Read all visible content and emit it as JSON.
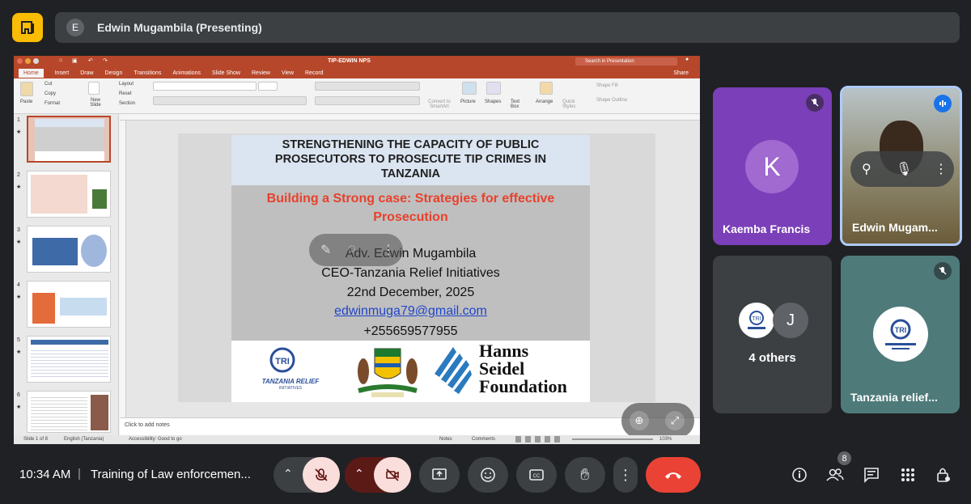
{
  "top": {
    "presenter_initial": "E",
    "presenter_label": "Edwin Mugambila (Presenting)"
  },
  "ppt": {
    "filename": "TIP-EDWIN NPS",
    "search_placeholder": "Search in Presentation",
    "share_label": "Share",
    "tabs": [
      "Home",
      "Insert",
      "Draw",
      "Design",
      "Transitions",
      "Animations",
      "Slide Show",
      "Review",
      "View",
      "Record"
    ],
    "ribbon": {
      "paste": "Paste",
      "cut": "Cut",
      "copy": "Copy",
      "format": "Format",
      "new_slide": "New Slide",
      "layout": "Layout",
      "reset": "Reset",
      "section": "Section",
      "convert": "Convert to SmartArt",
      "picture": "Picture",
      "shapes": "Shapes",
      "text_box": "Text Box",
      "arrange": "Arrange",
      "quick_styles": "Quick Styles",
      "shape_fill": "Shape Fill",
      "shape_outline": "Shape Outline"
    },
    "thumb_numbers": [
      "1",
      "2",
      "3",
      "4",
      "5",
      "6"
    ],
    "notes_placeholder": "Click to add notes",
    "status": {
      "slide_of": "Slide 1 of 8",
      "language": "English (Tanzania)",
      "accessibility": "Accessibility: Good to go",
      "notes": "Notes",
      "comments": "Comments",
      "zoom": "103%"
    }
  },
  "slide": {
    "title": "STRENGTHENING THE CAPACITY OF PUBLIC PROSECUTORS TO PROSECUTE TIP CRIMES IN TANZANIA",
    "subtitle": "Building a Strong case: Strategies for effective Prosecution",
    "presenter": "Adv. Edwin Mugambila",
    "role": "CEO-Tanzania Relief Initiatives",
    "date": "22nd  December, 2025",
    "email": "edwinmuga79@gmail.com",
    "phone": "+255659577955",
    "logo_left_name": "TANZANIA RELIEF",
    "logo_left_sub": "INITIATIVES",
    "logo_right_1": "Hanns",
    "logo_right_2": "Seidel",
    "logo_right_3": "Foundation",
    "title_color": "#1f1f1f",
    "subtitle_color": "#e8412c"
  },
  "tiles": {
    "kaemba_initial": "K",
    "kaemba_name": "Kaemba Francis",
    "edwin_name": "Edwin Mugam...",
    "others_initial": "J",
    "others_label": "4 others",
    "relief_name": "Tanzania relief..."
  },
  "bottom": {
    "time": "10:34 AM",
    "separator": "|",
    "meeting": "Training of Law enforcemen...",
    "people_count": "8"
  },
  "colors": {
    "meet_bg": "#202124",
    "accent_yellow": "#fbbc04",
    "end_call": "#ea4335",
    "muted_btn": "#f9dedc",
    "tile_purple": "#7b3fb9",
    "tile_teal": "#4f7a7a"
  }
}
